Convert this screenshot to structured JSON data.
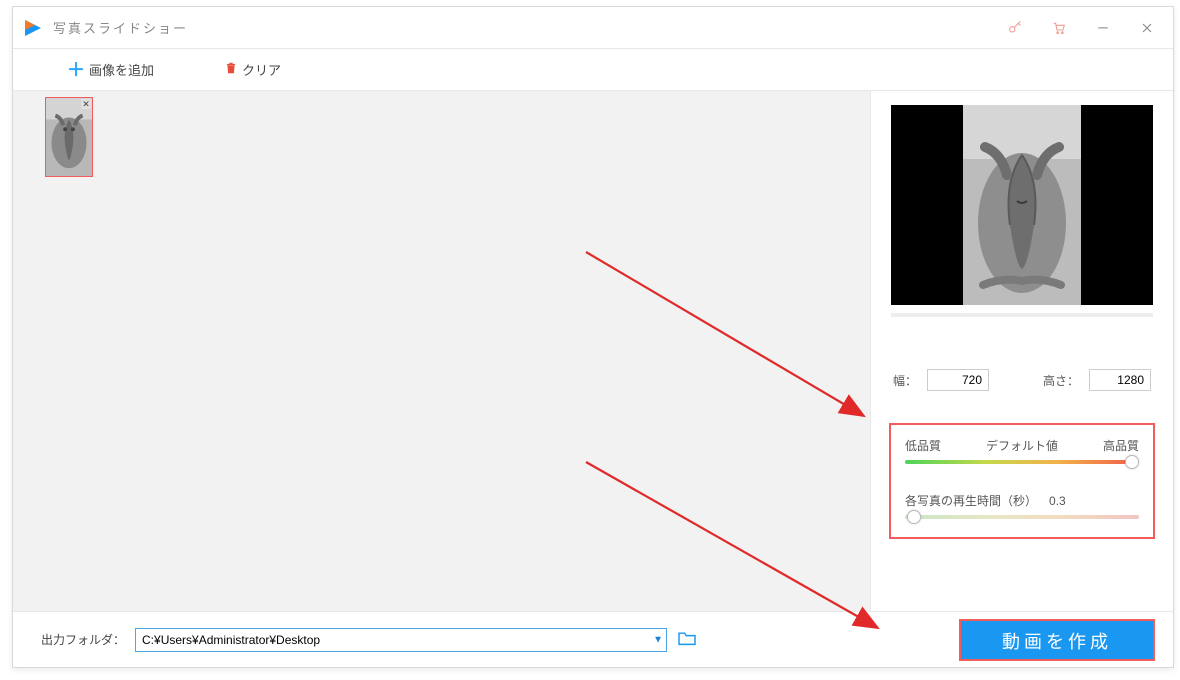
{
  "titlebar": {
    "title": "写真スライドショー"
  },
  "toolbar": {
    "add_images": "画像を追加",
    "clear": "クリア"
  },
  "dimensions": {
    "width_label": "幅：",
    "width_value": "720",
    "height_label": "高さ：",
    "height_value": "1280"
  },
  "quality": {
    "low": "低品質",
    "default": "デフォルト値",
    "high": "高品質"
  },
  "duration": {
    "label": "各写真の再生時間（秒）",
    "value": "0.3"
  },
  "footer": {
    "output_label": "出力フォルダ：",
    "output_path": "C:¥Users¥Administrator¥Desktop",
    "create_button": "動画を作成"
  }
}
